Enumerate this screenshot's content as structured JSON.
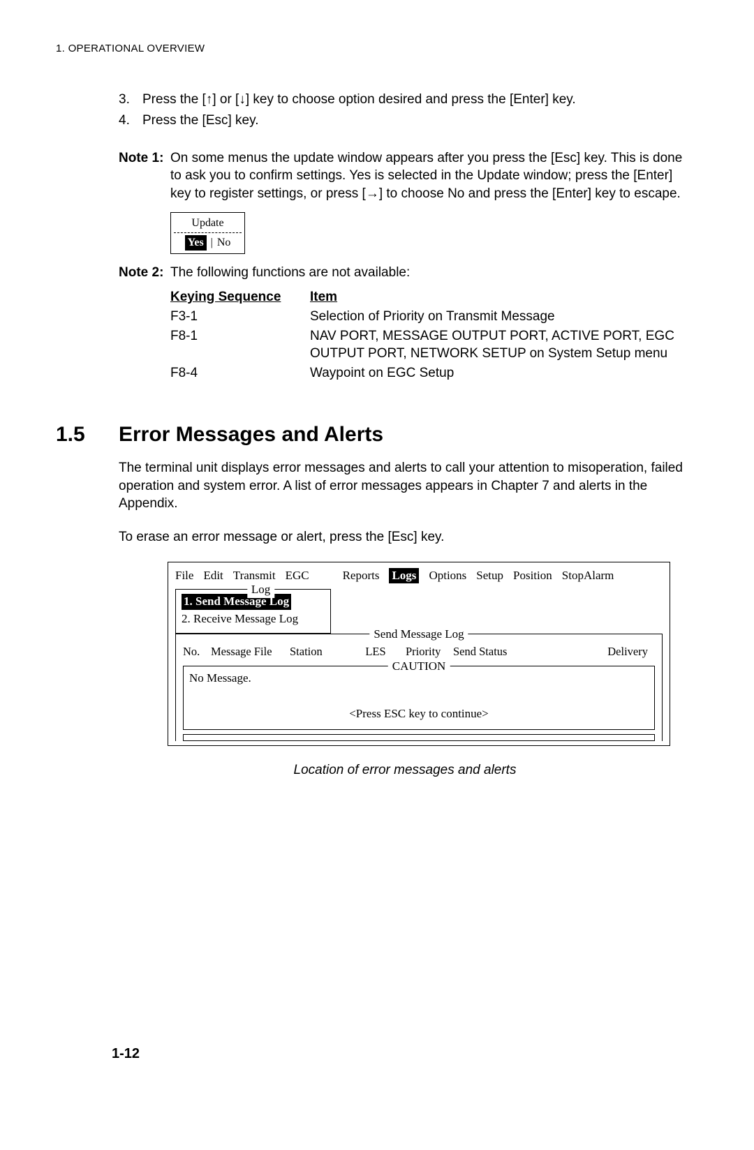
{
  "running_header": "1. OPERATIONAL OVERVIEW",
  "steps": {
    "s3": {
      "num": "3.",
      "text_before": "Press the [",
      "up": "↑",
      "mid": "] or [",
      "down": "↓",
      "text_after": "] key to choose option desired and press the [Enter] key."
    },
    "s4": {
      "num": "4.",
      "text": "Press the [Esc] key."
    }
  },
  "notes": {
    "n1": {
      "label": "Note 1:",
      "text_before": "On some menus the update window appears after you press the [Esc] key. This is done to ask you to confirm settings. Yes is selected in the Update window; press the [Enter] key to register settings, or press [",
      "arrow": "→",
      "text_after": "] to choose No and press the [Enter] key to escape."
    },
    "n2": {
      "label": "Note 2:",
      "text": "The following functions are not available:"
    }
  },
  "update_box": {
    "title": "Update",
    "yes": "Yes",
    "no": "No"
  },
  "ks_table": {
    "head_key": "Keying Sequence",
    "head_item": "Item",
    "rows": [
      {
        "k": "F3-1",
        "v": "Selection of Priority on Transmit Message"
      },
      {
        "k": "F8-1",
        "v": "NAV PORT, MESSAGE OUTPUT PORT, ACTIVE PORT, EGC OUTPUT PORT, NETWORK SETUP on System Setup menu"
      },
      {
        "k": "F8-4",
        "v": "Waypoint on EGC Setup"
      }
    ]
  },
  "section": {
    "num": "1.5",
    "title": "Error Messages and Alerts"
  },
  "para1": "The terminal unit displays error messages and alerts to call your attention to misoperation, failed operation and system error. A list of error messages appears in Chapter 7 and alerts in the Appendix.",
  "para2": "To erase an error message or alert, press the [Esc] key.",
  "terminal": {
    "menu": [
      "File",
      "Edit",
      "Transmit",
      "EGC",
      "Reports",
      "Logs",
      "Options",
      "Setup",
      "Position",
      "StopAlarm"
    ],
    "selected_menu_index": 5,
    "log_box": {
      "legend": "Log",
      "item1": "1. Send Message Log",
      "item2": "2. Receive Message Log"
    },
    "sml_legend": "Send Message Log",
    "cols": [
      "No.",
      "Message File",
      "Station",
      "LES",
      "Priority",
      "Send Status",
      "Delivery"
    ],
    "caution_legend": "CAUTION",
    "no_message": "No Message.",
    "press_esc": "<Press ESC key to continue>"
  },
  "fig_caption": "Location of error messages and alerts",
  "page_num": "1-12"
}
